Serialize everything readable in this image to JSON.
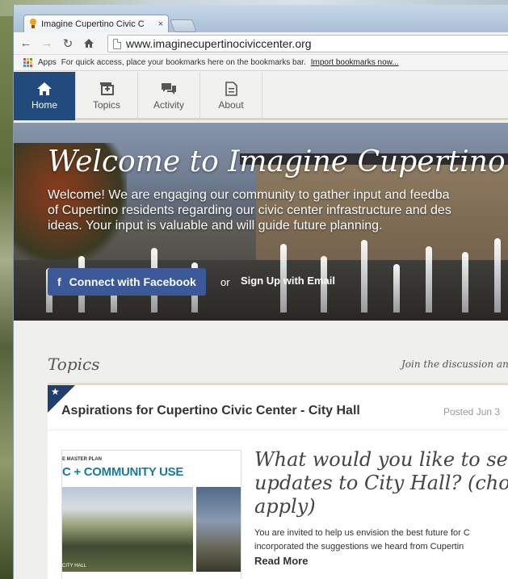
{
  "browser": {
    "tab_title": "Imagine Cupertino Civic C",
    "tab_close": "×",
    "url": "www.imaginecupertinociviccenter.org",
    "apps_label": "Apps",
    "bookmarks_hint": "For quick access, place your bookmarks here on the bookmarks bar.",
    "import_link": "Import bookmarks now..."
  },
  "nav": {
    "items": [
      {
        "label": "Home",
        "icon": "home-icon"
      },
      {
        "label": "Topics",
        "icon": "topics-icon"
      },
      {
        "label": "Activity",
        "icon": "activity-icon"
      },
      {
        "label": "About",
        "icon": "about-icon"
      }
    ]
  },
  "hero": {
    "title": "Welcome to Imagine Cupertino",
    "lines": [
      "Welcome! We are engaging our community to gather input and feedba",
      "of Cupertino residents regarding our civic center infrastructure and des",
      "ideas. Your input is valuable and will guide future planning."
    ],
    "facebook_button": "Connect with Facebook",
    "or": "or",
    "signup": "Sign Up with Email"
  },
  "topics": {
    "heading": "Topics",
    "join_text": "Join the discussion an"
  },
  "card": {
    "title": "Aspirations for Cupertino Civic Center - City Hall",
    "posted": "Posted Jun 3",
    "thumb": {
      "caption_top": "E MASTER PLAN",
      "caption_main": "C + COMMUNITY USE",
      "caption_bottom": "CITY HALL"
    },
    "question_lines": [
      "What would you like to se",
      "updates to City Hall? (cho",
      "apply)"
    ],
    "text_lines": [
      "You are invited to help us envision the best future for C",
      "incorporated the suggestions we heard from Cupertin"
    ],
    "read_more": "Read More"
  },
  "colors": {
    "nav_active": "#234a7c",
    "facebook": "#3b5998",
    "corner": "#1f3f6e"
  }
}
